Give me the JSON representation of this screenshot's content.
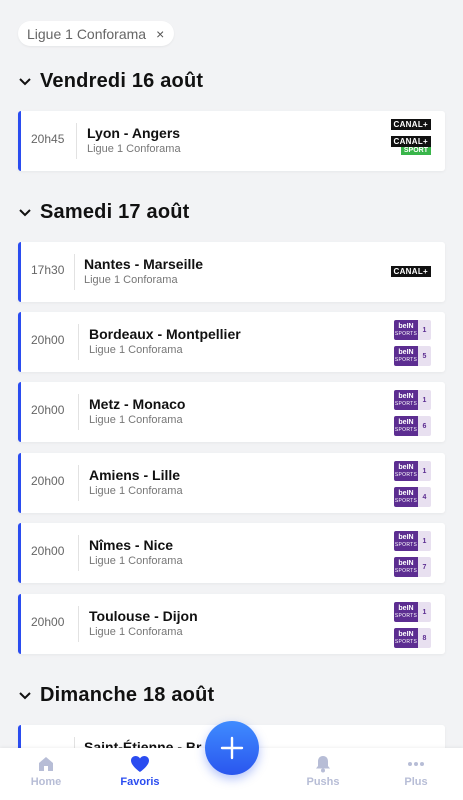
{
  "filter_chip": {
    "label": "Ligue 1 Conforama",
    "close": "×"
  },
  "days": [
    {
      "title": "Vendredi 16 août",
      "matches": [
        {
          "time": "20h45",
          "teams": "Lyon - Angers",
          "competition": "Ligue 1 Conforama",
          "channels": [
            "CANAL+",
            "CANAL+ SPORT"
          ]
        }
      ]
    },
    {
      "title": "Samedi 17 août",
      "matches": [
        {
          "time": "17h30",
          "teams": "Nantes - Marseille",
          "competition": "Ligue 1 Conforama",
          "channels": [
            "CANAL+"
          ]
        },
        {
          "time": "20h00",
          "teams": "Bordeaux - Montpellier",
          "competition": "Ligue 1 Conforama",
          "channels": [
            "beIN SPORTS 1",
            "beIN SPORTS 5"
          ]
        },
        {
          "time": "20h00",
          "teams": "Metz - Monaco",
          "competition": "Ligue 1 Conforama",
          "channels": [
            "beIN SPORTS 1",
            "beIN SPORTS 6"
          ]
        },
        {
          "time": "20h00",
          "teams": "Amiens - Lille",
          "competition": "Ligue 1 Conforama",
          "channels": [
            "beIN SPORTS 1",
            "beIN SPORTS 4"
          ]
        },
        {
          "time": "20h00",
          "teams": "Nîmes - Nice",
          "competition": "Ligue 1 Conforama",
          "channels": [
            "beIN SPORTS 1",
            "beIN SPORTS 7"
          ]
        },
        {
          "time": "20h00",
          "teams": "Toulouse - Dijon",
          "competition": "Ligue 1 Conforama",
          "channels": [
            "beIN SPORTS 1",
            "beIN SPORTS 8"
          ]
        }
      ]
    },
    {
      "title": "Dimanche 18 août",
      "matches": [
        {
          "time": "",
          "teams": "Saint-Étienne - Br",
          "competition": "",
          "channels": []
        }
      ]
    }
  ],
  "canal_logo": {
    "canal": "CANAL+",
    "sport": "SPORT"
  },
  "bein_logo": {
    "top": "beIN",
    "bottom": "SPORTS"
  },
  "channel_numbers": [
    "1",
    "5",
    "1",
    "6",
    "1",
    "4",
    "1",
    "7",
    "1",
    "8"
  ],
  "bottom_nav": [
    {
      "label": "Home",
      "icon": "home-icon"
    },
    {
      "label": "Favoris",
      "icon": "heart-icon",
      "active": true
    },
    {
      "label": "Pushs",
      "icon": "bell-icon"
    },
    {
      "label": "Plus",
      "icon": "more-dots-icon"
    }
  ],
  "fab": {
    "icon": "plus-icon"
  },
  "colors": {
    "accent": "#2a4cf0",
    "bein": "#5c2d91",
    "canal_sport": "#39b54a",
    "nav_inactive": "#b7bdd6"
  }
}
